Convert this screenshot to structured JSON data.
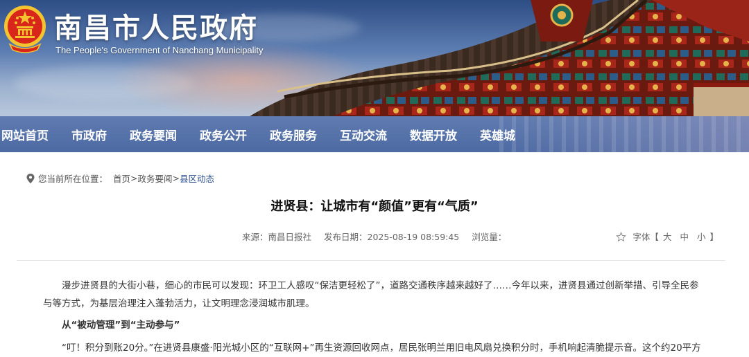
{
  "header": {
    "title": "南昌市人民政府",
    "subtitle": "The People's Government of Nanchang Municipality"
  },
  "nav": {
    "items": [
      "网站首页",
      "市政府",
      "政务要闻",
      "政务公开",
      "政务服务",
      "互动交流",
      "数据开放",
      "英雄城"
    ]
  },
  "breadcrumb": {
    "label": "您当前所在位置：",
    "items": [
      "首页",
      "政务要闻",
      "县区动态"
    ],
    "separator": ">"
  },
  "article": {
    "title": "进贤县：让城市有“颜值”更有“气质”",
    "source": "来源：南昌日报社",
    "date": "发布日期：2025-08-19 08:59:45",
    "views": "浏览量：",
    "fontsize": {
      "label": "字体【",
      "large": "大",
      "medium": "中",
      "small": "小",
      "close": "】"
    },
    "paragraphs": [
      "漫步进贤县的大街小巷，细心的市民可以发现：环卫工人感叹“保洁更轻松了”，道路交通秩序越来越好了……今年以来，进贤县通过创新举措、引导全民参与等方式，为基层治理注入蓬勃活力，让文明理念浸润城市肌理。",
      "从“被动管理”到“主动参与”",
      "“叮！积分到账20分。”在进贤县康盛·阳光城小区的“互联网+”再生资源回收网点，居民张明兰用旧电风扇兑换积分时，手机响起清脆提示音。这个约20平方"
    ]
  },
  "colors": {
    "nav_bg": "#4d6aa3",
    "breadcrumb_current": "#2e4f8c",
    "emblem_red": "#d8261a",
    "emblem_gold": "#f4c430"
  },
  "icons": [
    "national-emblem-icon",
    "location-pin-icon",
    "star-icon"
  ]
}
